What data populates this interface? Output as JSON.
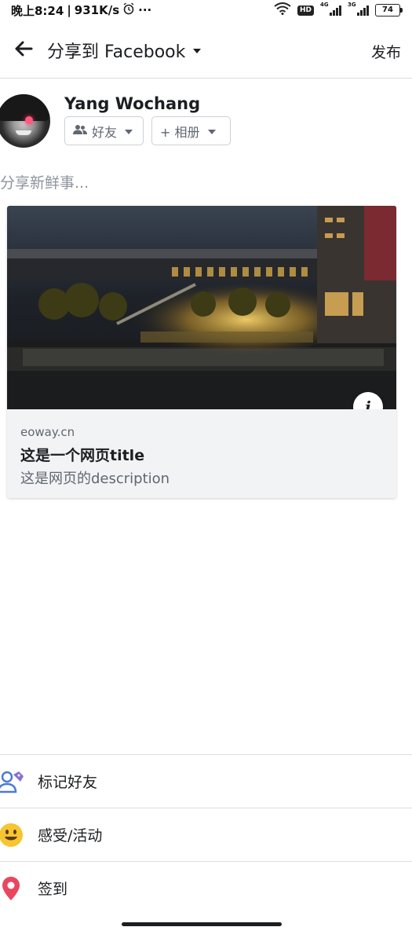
{
  "status_bar": {
    "time": "晚上8:24",
    "speed": "931K/s",
    "more": "···",
    "hd": "HD",
    "net1": "4G",
    "net2": "3G",
    "battery": "74"
  },
  "app_bar": {
    "title": "分享到 Facebook",
    "publish_label": "发布"
  },
  "author": {
    "name": "Yang Wochang",
    "audience_label": "好友",
    "album_label": "+ 相册"
  },
  "composer": {
    "placeholder": "分享新鲜事..."
  },
  "link_preview": {
    "domain": "eoway.cn",
    "title": "这是一个网页title",
    "description": "这是网页的description",
    "info_icon_glyph": "i"
  },
  "actions": [
    {
      "label": "标记好友",
      "icon": "tag-friends-icon"
    },
    {
      "label": "感受/活动",
      "icon": "feeling-smiley-icon"
    },
    {
      "label": "签到",
      "icon": "location-pin-icon"
    }
  ],
  "colors": {
    "accent_blue": "#4a7bd4",
    "smiley_yellow": "#f7c531",
    "pin_red": "#e94760",
    "muted_text": "#606770",
    "divider": "#dadde1"
  }
}
